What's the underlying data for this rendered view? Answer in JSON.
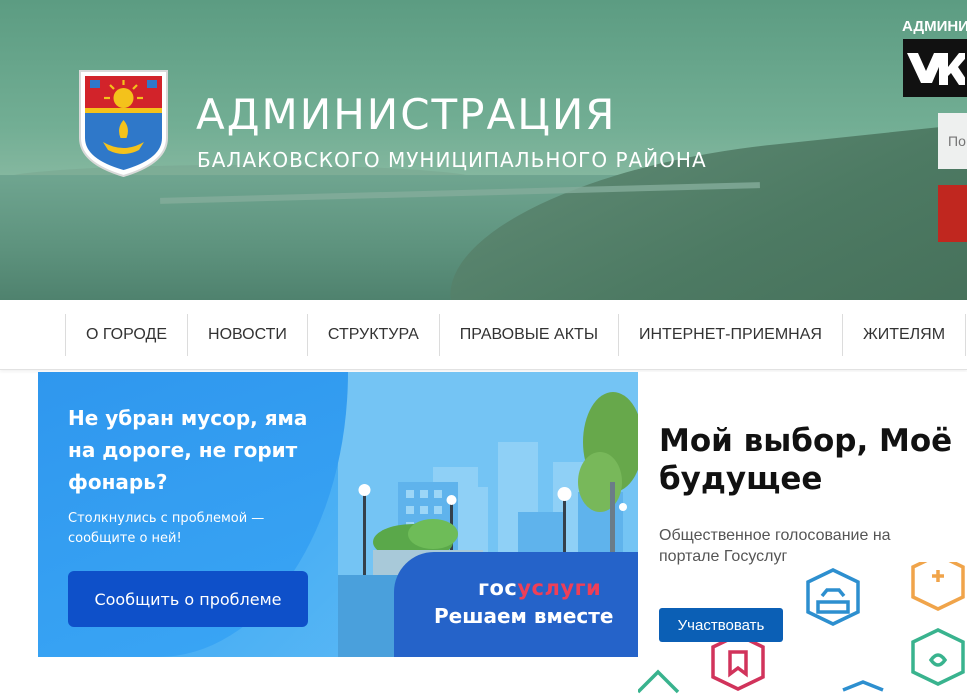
{
  "header": {
    "title": "АДМИНИСТРАЦИЯ",
    "subtitle": "БАЛАКОВСКОГО МУНИЦИПАЛЬНОГО РАЙОНА",
    "admin_label": "АДМИНИ",
    "search_placeholder": "По",
    "crest_icon": "city-coat-of-arms-icon",
    "vk_icon": "vk-logo-icon"
  },
  "nav": {
    "items": [
      {
        "label": "О ГОРОДЕ"
      },
      {
        "label": "НОВОСТИ"
      },
      {
        "label": "СТРУКТУРА"
      },
      {
        "label": "ПРАВОВЫЕ АКТЫ"
      },
      {
        "label": "ИНТЕРНЕТ-ПРИЕМНАЯ"
      },
      {
        "label": "ЖИТЕЛЯМ"
      }
    ]
  },
  "banner_report": {
    "title": "Не убран мусор, яма на дороге, не горит фонарь?",
    "text": "Столкнулись с проблемой — сообщите о ней!",
    "button": "Сообщить о проблеме",
    "logo_part1": "гос",
    "logo_part2": "услуги",
    "slogan": "Решаем вместе"
  },
  "banner_vote": {
    "title": "Мой выбор, Моё будущее",
    "text": "Общественное голосование на портале Госуслуг",
    "button": "Участвовать"
  },
  "colors": {
    "header_green": "#5f9f84",
    "report_blue": "#3aa2f2",
    "report_button": "#0e50c9",
    "gos_red": "#ee3f58",
    "vote_button": "#0b5fb5",
    "red_button": "#c0271f"
  }
}
